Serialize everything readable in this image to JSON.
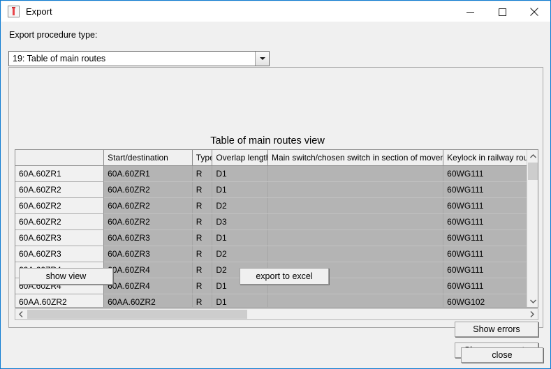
{
  "window": {
    "title": "Export",
    "icon": "export-signal-icon",
    "controls": {
      "minimize": "minimize-icon",
      "maximize": "maximize-icon",
      "close": "close-icon"
    }
  },
  "form": {
    "procedure_label": "Export procedure type:",
    "procedure_value": "19: Table of main routes",
    "dropdown_icon": "chevron-down-icon"
  },
  "view": {
    "title": "Table of main routes view",
    "table": {
      "headers": [
        "",
        "Start/destination",
        "Type",
        "Overlap length",
        "Main switch/chosen switch in section of movement",
        "Keylock in railway route locke"
      ],
      "rows": [
        [
          "60A.60ZR1",
          "60A.60ZR1",
          "R",
          "D1",
          "",
          "60WG111"
        ],
        [
          "60A.60ZR2",
          "60A.60ZR2",
          "R",
          "D1",
          "",
          "60WG111"
        ],
        [
          "60A.60ZR2",
          "60A.60ZR2",
          "R",
          "D2",
          "",
          "60WG111"
        ],
        [
          "60A.60ZR2",
          "60A.60ZR2",
          "R",
          "D3",
          "",
          "60WG111"
        ],
        [
          "60A.60ZR3",
          "60A.60ZR3",
          "R",
          "D1",
          "",
          "60WG111"
        ],
        [
          "60A.60ZR3",
          "60A.60ZR3",
          "R",
          "D2",
          "",
          "60WG111"
        ],
        [
          "60A.60ZR4",
          "60A.60ZR4",
          "R",
          "D2",
          "",
          "60WG111"
        ],
        [
          "60A.60ZR4",
          "60A.60ZR4",
          "R",
          "D1",
          "",
          "60WG111"
        ],
        [
          "60AA.60ZR2",
          "60AA.60ZR2",
          "R",
          "D1",
          "",
          "60WG102"
        ]
      ]
    },
    "scrollbars": {
      "vertical_up_icon": "chevron-up-icon",
      "vertical_down_icon": "chevron-down-icon",
      "horizontal_left_icon": "chevron-left-icon",
      "horizontal_right_icon": "chevron-right-icon"
    }
  },
  "buttons": {
    "show_view": "show view",
    "export_to_excel": "export to excel",
    "show_errors": "Show errors",
    "show_comments": "Show comments",
    "close": "close"
  },
  "colors": {
    "window_border": "#0b7ad1",
    "dialog_background": "#f0f0f0",
    "grid_cell": "#b4b4b4",
    "grid_header": "#f0f0f0",
    "row_header": "#f1f1f1",
    "icon_red": "#e8454a"
  }
}
